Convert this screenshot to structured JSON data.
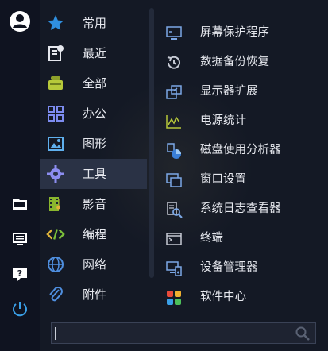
{
  "categories": [
    {
      "label": "常用",
      "icon": "star-icon"
    },
    {
      "label": "最近",
      "icon": "recent-icon"
    },
    {
      "label": "全部",
      "icon": "all-apps-icon"
    },
    {
      "label": "办公",
      "icon": "office-icon"
    },
    {
      "label": "图形",
      "icon": "graphics-icon"
    },
    {
      "label": "工具",
      "icon": "gear-icon"
    },
    {
      "label": "影音",
      "icon": "multimedia-icon"
    },
    {
      "label": "编程",
      "icon": "code-icon"
    },
    {
      "label": "网络",
      "icon": "globe-icon"
    },
    {
      "label": "附件",
      "icon": "paperclip-icon"
    }
  ],
  "active_category": "工具",
  "apps": [
    {
      "label": "屏幕保护程序",
      "icon": "screensaver-icon"
    },
    {
      "label": "数据备份恢复",
      "icon": "backup-restore-icon"
    },
    {
      "label": "显示器扩展",
      "icon": "display-extend-icon"
    },
    {
      "label": "电源统计",
      "icon": "power-stats-icon"
    },
    {
      "label": "磁盘使用分析器",
      "icon": "disk-analyzer-icon"
    },
    {
      "label": "窗口设置",
      "icon": "window-settings-icon"
    },
    {
      "label": "系统日志查看器",
      "icon": "log-viewer-icon"
    },
    {
      "label": "终端",
      "icon": "terminal-icon"
    },
    {
      "label": "设备管理器",
      "icon": "device-manager-icon"
    },
    {
      "label": "软件中心",
      "icon": "software-center-icon"
    }
  ],
  "rail": [
    "user-avatar-icon",
    "folder-icon",
    "monitor-settings-icon",
    "help-icon",
    "power-icon"
  ],
  "search": {
    "placeholder": "",
    "value": ""
  },
  "colors": {
    "accent": "#3aa0e8",
    "active_bg": "#2a3245",
    "text": "#e6e8ee"
  }
}
